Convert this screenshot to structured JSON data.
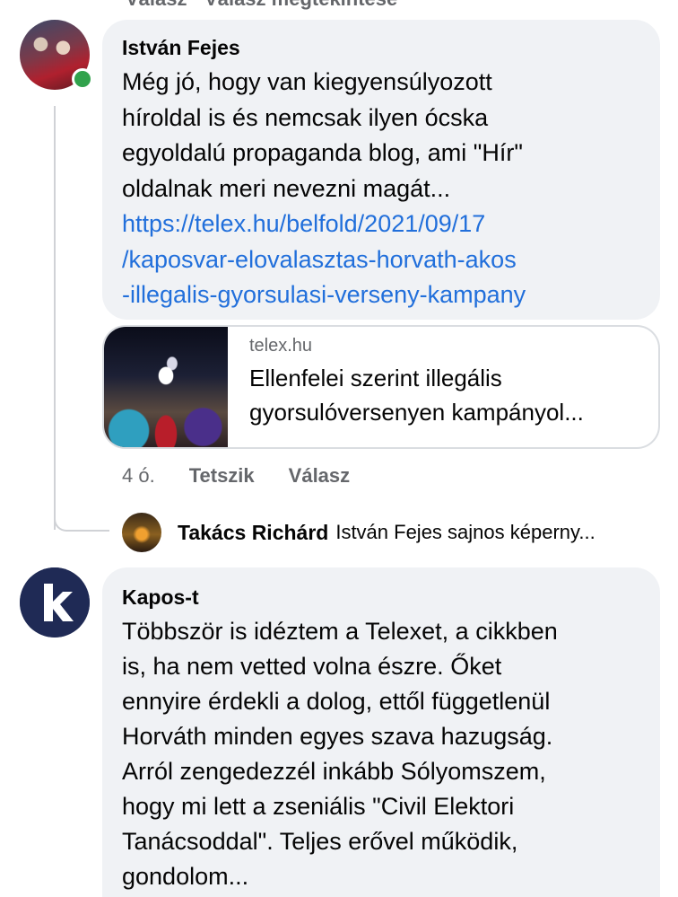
{
  "top_cutoff_text": "Válasz · Válasz megtekintése",
  "comment_1": {
    "author": "István Fejes",
    "lines": [
      "Még jó, hogy van kiegyensúlyozott",
      "híroldal is és nemcsak ilyen ócska",
      "egyoldalú propaganda blog, ami \"Hír\"",
      "oldalnak meri nevezni magát..."
    ],
    "link_lines": [
      "https://telex.hu/belfold/2021/09/17",
      "/kaposvar-elovalasztas-horvath-akos",
      "-illegalis-gyorsulasi-verseny-kampany"
    ],
    "preview": {
      "domain": "telex.hu",
      "title_lines": [
        "Ellenfelei szerint illegális",
        "gyorsulóversenyen kampányol..."
      ]
    },
    "time": "4 ó.",
    "like_label": "Tetszik",
    "reply_label": "Válasz"
  },
  "reply_preview": {
    "author": "Takács Richárd",
    "text": "István Fejes sajnos képerny..."
  },
  "comment_2": {
    "author": "Kapos-t",
    "avatar_letter": "k",
    "lines": [
      "Többször is idéztem a Telexet, a cikkben",
      "is, ha nem vetted volna észre. Őket",
      "ennyire érdekli a dolog, ettől függetlenül",
      "Horváth minden egyes szava hazugság.",
      "Arról zengedezzél inkább Sólyomszem,",
      "hogy mi lett a zseniális \"Civil Elektori",
      "Tanácsoddal\". Teljes erővel működik,",
      "gondolom..."
    ]
  },
  "colors": {
    "bubble": "#f0f2f5",
    "link": "#216fdb",
    "meta": "#65676b",
    "online": "#31a24c",
    "kapos_avatar": "#1f2a55"
  }
}
